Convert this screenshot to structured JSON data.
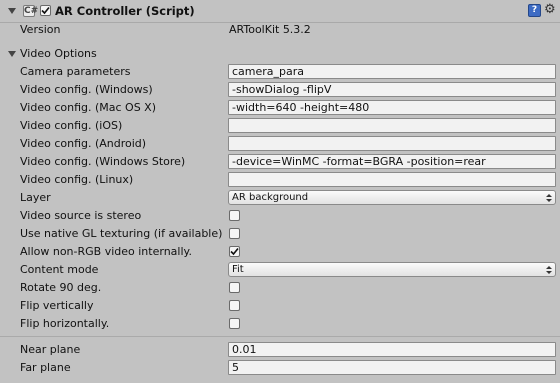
{
  "header": {
    "title": "AR Controller (Script)",
    "script_icon_glyph": "C#",
    "enabled": true,
    "help_glyph": "?",
    "gear_glyph": "⚙"
  },
  "version": {
    "label": "Version",
    "value": "ARToolKit 5.3.2"
  },
  "video_options": {
    "label": "Video Options",
    "expanded": true,
    "camera_parameters": {
      "label": "Camera parameters",
      "value": "camera_para"
    },
    "config_windows": {
      "label": "Video config. (Windows)",
      "value": "-showDialog -flipV"
    },
    "config_macos": {
      "label": "Video config. (Mac OS X)",
      "value": "-width=640 -height=480"
    },
    "config_ios": {
      "label": "Video config. (iOS)",
      "value": ""
    },
    "config_android": {
      "label": "Video config. (Android)",
      "value": ""
    },
    "config_windows_store": {
      "label": "Video config. (Windows Store)",
      "value": "-device=WinMC -format=BGRA -position=rear"
    },
    "config_linux": {
      "label": "Video config. (Linux)",
      "value": ""
    },
    "layer": {
      "label": "Layer",
      "value": "AR background"
    },
    "stereo": {
      "label": "Video source is stereo",
      "checked": false
    },
    "native_gl": {
      "label": "Use native GL texturing (if available)",
      "checked": false
    },
    "non_rgb": {
      "label": "Allow non-RGB video internally.",
      "checked": true
    },
    "content_mode": {
      "label": "Content mode",
      "value": "Fit"
    },
    "rotate_90": {
      "label": "Rotate 90 deg.",
      "checked": false
    },
    "flip_vertical": {
      "label": "Flip vertically",
      "checked": false
    },
    "flip_horizontal": {
      "label": "Flip horizontally.",
      "checked": false
    }
  },
  "planes": {
    "near": {
      "label": "Near plane",
      "value": "0.01"
    },
    "far": {
      "label": "Far plane",
      "value": "5"
    }
  },
  "colors": {
    "panel_bg": "#c2c2c2",
    "field_bg": "#f2f2f2",
    "checkmark": "#111111",
    "help_icon": "#3d6bc4"
  },
  "icons": {
    "foldout": "triangle-down-icon",
    "script": "csharp-script-icon",
    "help": "help-icon",
    "gear": "gear-icon",
    "check": "checkmark-icon",
    "dropdown": "dropdown-arrows-icon"
  }
}
